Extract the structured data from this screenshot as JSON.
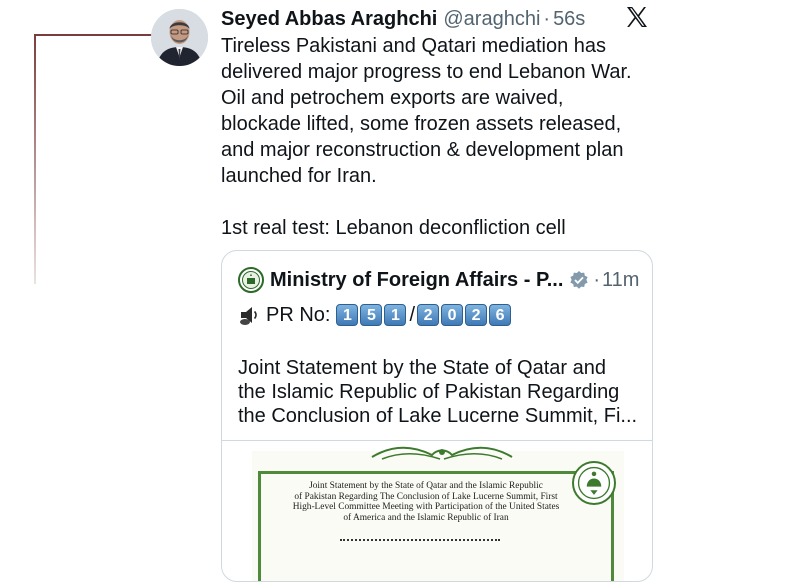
{
  "tweet": {
    "author_name": "Seyed Abbas Araghchi",
    "handle": "@araghchi",
    "separator": "·",
    "time": "56s",
    "lines": [
      "Tireless Pakistani and Qatari mediation has",
      "delivered major progress to end Lebanon War.",
      "Oil and petrochem exports are waived,",
      "blockade lifted, some frozen assets released,",
      "and major reconstruction & development plan",
      "launched for Iran."
    ],
    "line2": "1st real test: Lebanon deconfliction cell"
  },
  "quoted": {
    "author_name": "Ministry of Foreign Affairs - P...",
    "separator": "·",
    "time": "11m",
    "pr_label": "PR No:",
    "pr_digits_a": [
      "1",
      "5",
      "1"
    ],
    "pr_slash": "/",
    "pr_digits_b": [
      "2",
      "0",
      "2",
      "6"
    ],
    "body_lines": [
      "Joint Statement by the State of Qatar and",
      "the Islamic Republic of Pakistan Regarding",
      "the Conclusion of Lake Lucerne Summit, Fi..."
    ]
  },
  "document": {
    "lines": [
      "Joint Statement by the State of Qatar and the Islamic Republic",
      "of Pakistan Regarding The Conclusion of Lake Lucerne Summit, First",
      "High-Level Committee Meeting with Participation of the United States",
      "of America and the Islamic Republic of Iran"
    ]
  },
  "icons": {
    "x_logo": "x-logo-icon",
    "verified": "verified-badge-icon",
    "ministry_logo": "ministry-seal-icon",
    "pr": "speaker-icon"
  },
  "colors": {
    "text": "#0f1419",
    "secondary": "#536471",
    "border": "#cfd9de",
    "digit_blue": "#3f79b5",
    "doc_green": "#4e8a3a"
  }
}
